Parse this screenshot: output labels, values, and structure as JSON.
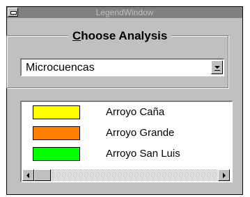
{
  "window": {
    "title": "LegendWindow",
    "sysmenu_icon": "window-menu-icon"
  },
  "analysis_group": {
    "title_accel": "C",
    "title_rest": "hoose Analysis",
    "selected_value": "Microcuencas"
  },
  "legend": {
    "items": [
      {
        "label": "Arroyo Caña",
        "color": "#ffff00"
      },
      {
        "label": "Arroyo Grande",
        "color": "#ff8000"
      },
      {
        "label": "Arroyo San Luis",
        "color": "#00ff00"
      }
    ]
  },
  "scrollbar": {
    "left_icon": "arrow-left-icon",
    "right_icon": "arrow-right-icon"
  }
}
